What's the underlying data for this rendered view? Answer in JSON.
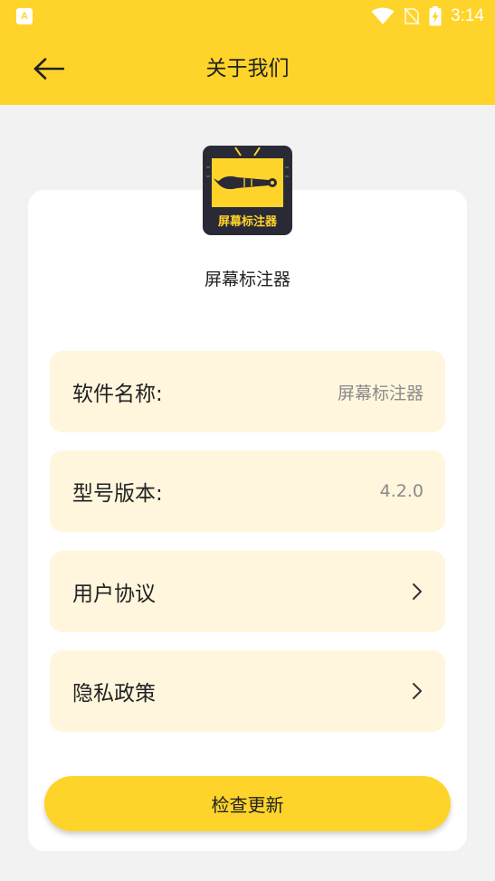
{
  "status_bar": {
    "time": "3:14",
    "notification_app_letter": "A",
    "icons": [
      "wifi-icon",
      "no-sim-icon",
      "battery-charging-icon"
    ]
  },
  "header": {
    "title": "关于我们",
    "back_icon": "arrow-left-icon"
  },
  "app": {
    "logo_text": "屏幕标注器",
    "name": "屏幕标注器"
  },
  "info_rows": [
    {
      "label": "软件名称:",
      "value": "屏幕标注器"
    },
    {
      "label": "型号版本:",
      "value": "4.2.0"
    },
    {
      "label": "用户协议",
      "icon": "chevron-right-icon"
    },
    {
      "label": "隐私政策",
      "icon": "chevron-right-icon"
    }
  ],
  "update_button": {
    "label": "检查更新"
  },
  "colors": {
    "primary": "#ffd42a",
    "row_bg": "#fff6dd",
    "page_bg": "#f2f2f2",
    "logo_bg": "#2a2a37",
    "muted_text": "#8a8a8a"
  }
}
